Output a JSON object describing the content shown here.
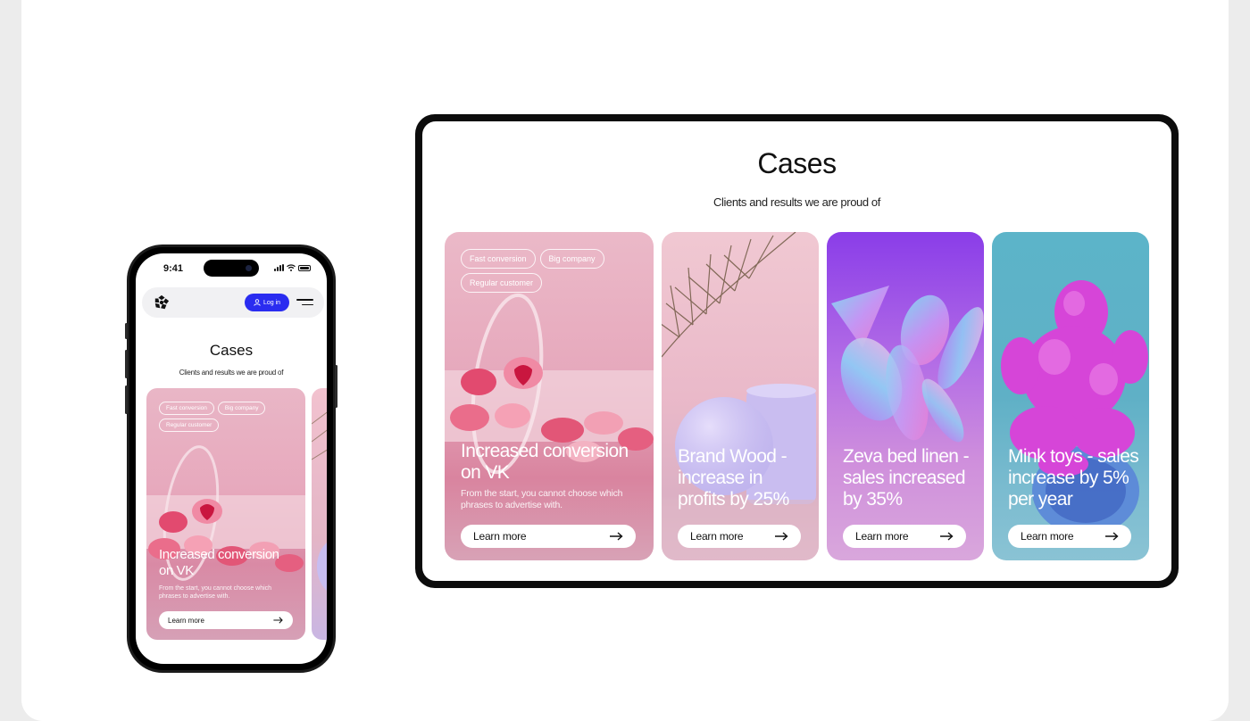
{
  "mobile": {
    "status_time": "9:41",
    "login_label": "Log in",
    "title": "Cases",
    "subtitle": "Clients and results we are proud of",
    "card": {
      "tags": [
        "Fast conversion",
        "Big company",
        "Regular customer"
      ],
      "title": "Increased conversion on VK",
      "description": "From the start, you cannot choose which phrases to advertise with.",
      "cta": "Learn more"
    }
  },
  "tablet": {
    "title": "Cases",
    "subtitle": "Clients and results we are proud of",
    "cards": [
      {
        "tags": [
          "Fast conversion",
          "Big company",
          "Regular customer"
        ],
        "title": "Increased conversion on VK",
        "description": "From the start, you cannot choose which phrases to advertise with.",
        "cta": "Learn more"
      },
      {
        "title": "Brand Wood - increase in profits by 25%",
        "cta": "Learn more"
      },
      {
        "title": "Zeva bed linen - sales increased by 35%",
        "cta": "Learn more"
      },
      {
        "title": "Mink toys - sales increase by 5% per year",
        "cta": "Learn more"
      }
    ]
  },
  "colors": {
    "accent": "#2a2cf0",
    "background": "#ececec",
    "card_pink": "#e6a8bc",
    "card_purple": "#8a3de8",
    "card_teal": "#5cb4c9"
  }
}
